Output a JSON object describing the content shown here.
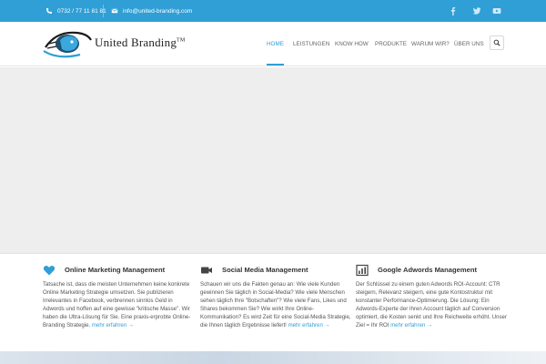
{
  "topbar": {
    "phone": "0732 / 77 11 81 81",
    "email": "info@united-branding.com",
    "social": [
      "facebook-icon",
      "twitter-icon",
      "youtube-icon"
    ]
  },
  "header": {
    "brand_name": "United Branding",
    "brand_tm": "TM",
    "nav": [
      {
        "label": "HOME",
        "active": true
      },
      {
        "label": "LEISTUNGEN",
        "active": false
      },
      {
        "label": "KNOW HOW",
        "active": false
      },
      {
        "label": "PRODUKTE",
        "active": false
      },
      {
        "label": "WARUM WIR?",
        "active": false
      },
      {
        "label": "ÜBER UNS",
        "active": false
      }
    ],
    "search_icon": "search-icon"
  },
  "features": [
    {
      "icon": "heart-icon",
      "title": "Online Marketing Management",
      "text": "Tatsache ist, dass die meisten Unternehmen keine konkrete Online Marketing Strategie umsetzen. Sie publizieren Irrelevantes in Facebook, verbrennen sinnlos Geld in Adwords und hoffen auf eine gewisse \"kritische Masse\". Wir haben die Ultra-Lösung für Sie. Eine praxis-erprobte Online-Branding Strategie.",
      "link": "mehr erfahren →"
    },
    {
      "icon": "video-camera-icon",
      "title": "Social Media Management",
      "text": "Schauen wir uns die Fakten genau an: Wie viele Kunden gewinnen Sie täglich in Social-Media? Wie viele Menschen sehen täglich Ihre \"Botschaften\"? Wie viele Fans, Likes und Shares bekommen Sie? Wie wirkt Ihre Online-Kommunikation? Es wird Zeit für eine Social-Media Strategie, die Ihnen täglich Ergebnisse liefert!",
      "link": "mehr erfahren →"
    },
    {
      "icon": "bar-chart-icon",
      "title": "Google Adwords Management",
      "text": "Der Schlüssel zu einem guten Adwords ROI-Account: CTR steigern, Relevanz steigern, eine gute Kontostruktur mit konstanter Performance-Optimierung. Die Lösung: Ein Adwords-Experte der Ihren Account täglich auf Conversion optimiert, die Kosten senkt und Ihre Reichweite erhöht. Unser Ziel = Ihr ROI",
      "link": "mehr erfahren →"
    }
  ],
  "colors": {
    "accent": "#2f9fd6",
    "slider_bg": "#eeeeee",
    "heading": "#333333"
  }
}
